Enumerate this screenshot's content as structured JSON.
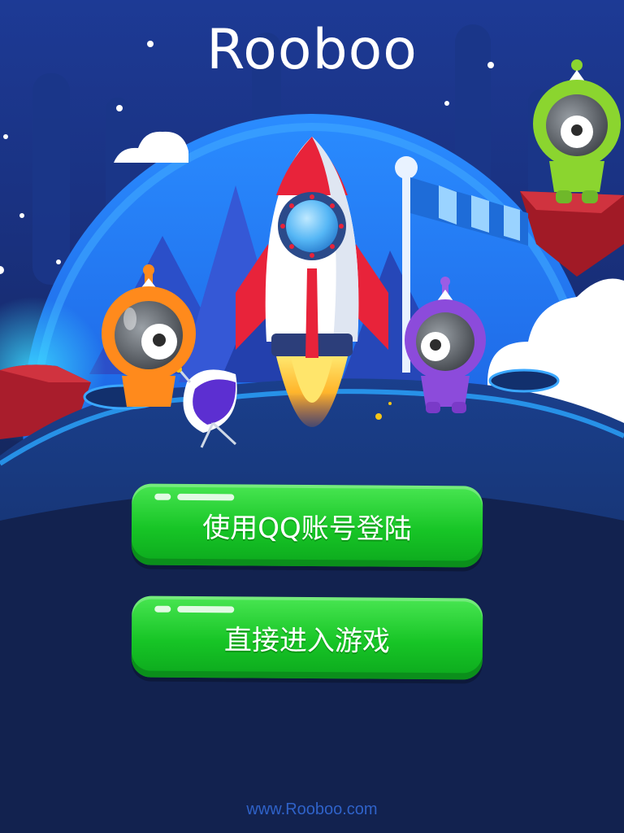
{
  "app": {
    "logo_text": "Rooboo"
  },
  "buttons": {
    "qq_login_label": "使用QQ账号登陆",
    "guest_play_label": "直接进入游戏"
  },
  "footer": {
    "url_text": "www.Rooboo.com"
  },
  "icons": {
    "rocket": "rocket-icon",
    "astronaut_orange": "astronaut-icon",
    "astronaut_purple": "astronaut-icon",
    "alien_green": "alien-icon",
    "satellite_dish": "satellite-dish-icon",
    "windsock": "windsock-icon",
    "cloud": "cloud-icon"
  },
  "colors": {
    "sky_dark": "#16286a",
    "planet_blue": "#1e6bea",
    "button_green": "#17c526",
    "rocket_red": "#e8233a",
    "footer_blue": "#2f62c8"
  }
}
